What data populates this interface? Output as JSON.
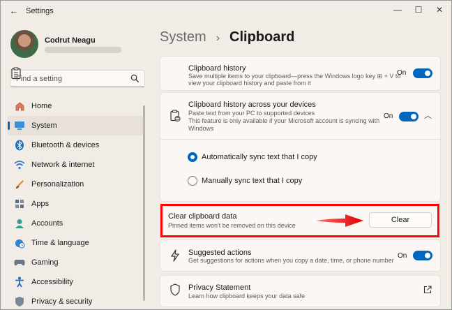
{
  "window": {
    "title": "Settings"
  },
  "user": {
    "name": "Codrut Neagu"
  },
  "search": {
    "placeholder": "Find a setting"
  },
  "nav": [
    {
      "label": "Home",
      "icon": "home-icon"
    },
    {
      "label": "System",
      "icon": "system-icon",
      "active": true
    },
    {
      "label": "Bluetooth & devices",
      "icon": "bluetooth-icon"
    },
    {
      "label": "Network & internet",
      "icon": "wifi-icon"
    },
    {
      "label": "Personalization",
      "icon": "brush-icon"
    },
    {
      "label": "Apps",
      "icon": "apps-icon"
    },
    {
      "label": "Accounts",
      "icon": "person-icon"
    },
    {
      "label": "Time & language",
      "icon": "globe-clock-icon"
    },
    {
      "label": "Gaming",
      "icon": "gamepad-icon"
    },
    {
      "label": "Accessibility",
      "icon": "accessibility-icon"
    },
    {
      "label": "Privacy & security",
      "icon": "shield-icon"
    }
  ],
  "breadcrumb": {
    "parent": "System",
    "separator": "›",
    "current": "Clipboard"
  },
  "clipboard_history": {
    "title": "Clipboard history",
    "desc_line1": "Save multiple items to your clipboard—press the Windows logo key ⊞ + V to",
    "desc_line2": "view your clipboard history and paste from it",
    "toggle_label": "On"
  },
  "sync": {
    "title": "Clipboard history across your devices",
    "desc_line1": "Paste text from your PC to supported devices",
    "desc_line2": "This feature is only available if your Microsoft account is syncing with",
    "desc_line3": "Windows",
    "toggle_label": "On",
    "option_auto": "Automatically sync text that I copy",
    "option_manual": "Manually sync text that I copy"
  },
  "clear": {
    "title": "Clear clipboard data",
    "desc": "Pinned items won't be removed on this device",
    "button": "Clear"
  },
  "suggested": {
    "title": "Suggested actions",
    "desc": "Get suggestions for actions when you copy a date, time, or phone number",
    "toggle_label": "On"
  },
  "privacy": {
    "title": "Privacy Statement",
    "desc": "Learn how clipboard keeps your data safe"
  },
  "colors": {
    "accent": "#0067c0",
    "highlight": "#ff0000",
    "background": "#f2ece6"
  }
}
